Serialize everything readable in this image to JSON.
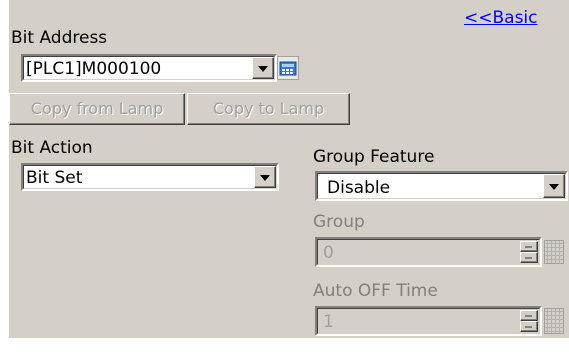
{
  "basic_link": "<<Basic",
  "bit_address": {
    "label": "Bit Address",
    "value": "[PLC1]M000100",
    "input_icon": "keypad-icon"
  },
  "buttons": {
    "copy_from_lamp": "Copy from Lamp",
    "copy_to_lamp": "Copy to Lamp"
  },
  "bit_action": {
    "label": "Bit Action",
    "value": "Bit Set"
  },
  "group_feature": {
    "label": "Group Feature",
    "value": "Disable"
  },
  "group": {
    "label": "Group",
    "value": "0"
  },
  "auto_off_time": {
    "label": "Auto OFF Time",
    "value": "1"
  },
  "colors": {
    "panel": "#d4d0c8",
    "link": "#0000ff",
    "disabled_text": "#808080"
  }
}
